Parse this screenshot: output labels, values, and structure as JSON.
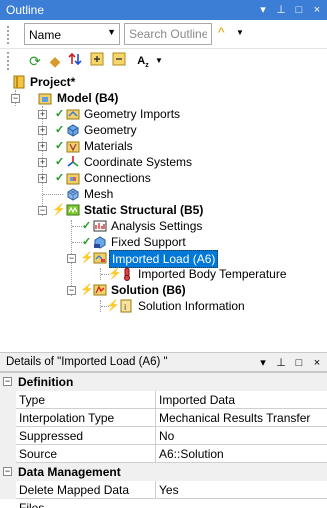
{
  "outline": {
    "title": "Outline",
    "controls": [
      "▾",
      "⊥",
      "□",
      "×"
    ],
    "filter_select": "Name",
    "search_placeholder": "Search Outline",
    "tree": [
      {
        "label": "Project*",
        "bold": true
      },
      {
        "label": "Model (B4)",
        "bold": true
      },
      {
        "label": "Geometry Imports"
      },
      {
        "label": "Geometry"
      },
      {
        "label": "Materials"
      },
      {
        "label": "Coordinate Systems"
      },
      {
        "label": "Connections"
      },
      {
        "label": "Mesh"
      },
      {
        "label": "Static Structural (B5)",
        "bold": true
      },
      {
        "label": "Analysis Settings"
      },
      {
        "label": "Fixed Support"
      },
      {
        "label": "Imported Load (A6)",
        "selected": true
      },
      {
        "label": "Imported Body Temperature"
      },
      {
        "label": "Solution (B6)",
        "bold": true
      },
      {
        "label": "Solution Information"
      }
    ]
  },
  "details": {
    "title": "Details of \"Imported Load (A6) \"",
    "controls": [
      "▾",
      "⊥",
      "□",
      "×"
    ],
    "sections": [
      {
        "name": "Definition",
        "rows": [
          {
            "key": "Type",
            "value": "Imported Data"
          },
          {
            "key": "Interpolation Type",
            "value": "Mechanical Results Transfer"
          },
          {
            "key": "Suppressed",
            "value": "No"
          },
          {
            "key": "Source",
            "value": "A6::Solution"
          }
        ]
      },
      {
        "name": "Data Management",
        "rows": [
          {
            "key": "Delete Mapped Data Files",
            "value": "Yes"
          }
        ]
      }
    ]
  }
}
